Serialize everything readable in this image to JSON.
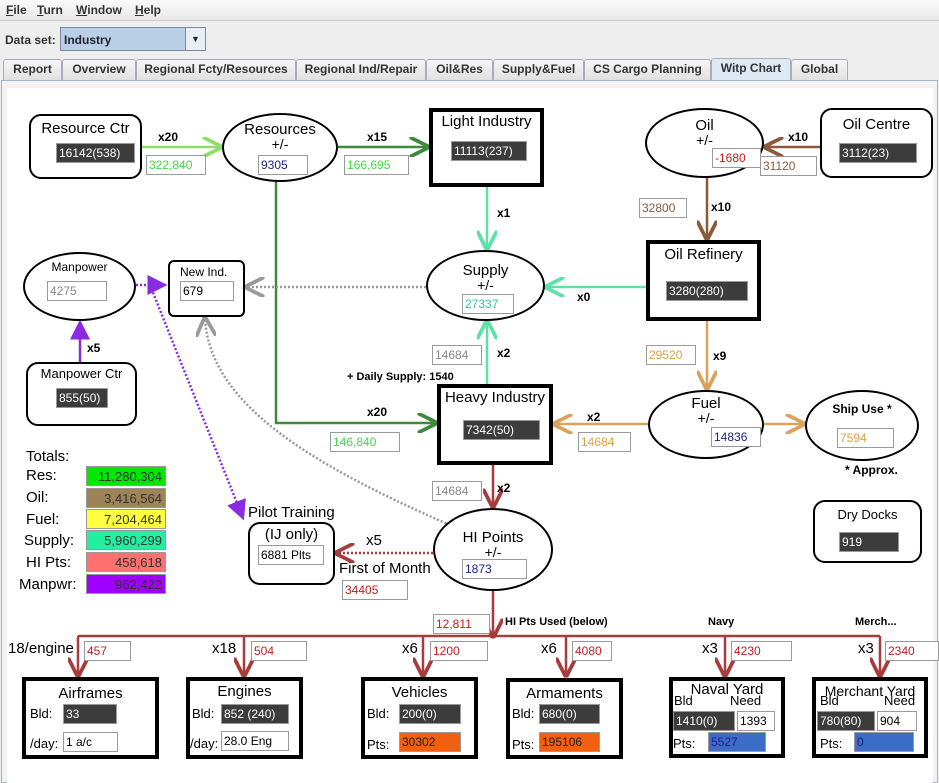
{
  "menu": [
    "File",
    "Turn",
    "Window",
    "Help"
  ],
  "dataset": {
    "label": "Data set:",
    "value": "Industry"
  },
  "tabs": [
    "Report",
    "Overview",
    "Regional Fcty/Resources",
    "Regional Ind/Repair",
    "Oil&Res",
    "Supply&Fuel",
    "CS Cargo Planning",
    "Witp Chart",
    "Global"
  ],
  "active_tab": "Witp Chart",
  "colors": {
    "resources": "#8fdc6a",
    "resources_dark": "#3d8a3d",
    "supply": "#5fe0a8",
    "oil": "#8b5a3c",
    "fuel": "#d9a35e",
    "hi": "#a83c3c",
    "manpower": "#8a2be2"
  },
  "chart": {
    "resource_ctr": {
      "title": "Resource Ctr",
      "value": "16142(538)",
      "mult": "x20",
      "flow": "322,840"
    },
    "resources": {
      "title": "Resources",
      "pm": "+/-",
      "value": "9305",
      "mult": "x15",
      "flow": "166,695"
    },
    "light_industry": {
      "title": "Light Industry",
      "value": "11113(237)",
      "mult": "x1"
    },
    "oil": {
      "title": "Oil",
      "pm": "+/-",
      "value": "-1680"
    },
    "oil_centre": {
      "title": "Oil Centre",
      "value": "3112(23)",
      "mult": "x10",
      "flow": "31120"
    },
    "oil_refinery": {
      "title": "Oil Refinery",
      "value": "3280(280)",
      "in_flow": "32800",
      "in_mult": "x10",
      "supply_mult": "x0",
      "fuel_flow": "29520",
      "fuel_mult": "x9"
    },
    "supply": {
      "title": "Supply",
      "pm": "+/-",
      "value": "27337"
    },
    "new_ind": {
      "title": "New Ind.",
      "value": "679"
    },
    "manpower": {
      "title": "Manpower",
      "value": "4275"
    },
    "manpower_ctr": {
      "title": "Manpower Ctr",
      "value": "855(50)",
      "mult": "x5"
    },
    "heavy_industry": {
      "title": "Heavy Industry",
      "value": "7342(50)",
      "supply_flow": "14684",
      "supply_mult": "x2",
      "daily_supply": "+ Daily Supply: 1540",
      "res_mult": "x20",
      "res_flow": "146,840",
      "fuel_mult": "x2",
      "fuel_flow": "14684",
      "hi_flow": "14684",
      "hi_mult": "x2"
    },
    "fuel": {
      "title": "Fuel",
      "pm": "+/-",
      "value": "14836"
    },
    "ship_use": {
      "title": "Ship Use *",
      "value": "7594",
      "note": "* Approx."
    },
    "hi_points": {
      "title": "HI Points",
      "pm": "+/-",
      "value": "1873",
      "used": "12,811",
      "used_label": "HI Pts Used (below)"
    },
    "dry_docks": {
      "title": "Dry Docks",
      "value": "919"
    },
    "pilot_training": {
      "title": "Pilot Training",
      "sub": "(IJ only)",
      "value": "6881 Plts",
      "mult": "x5",
      "when": "First of Month",
      "flow": "34405"
    },
    "totals": {
      "title": "Totals:",
      "items": [
        {
          "label": "Res:",
          "value": "11,280,304",
          "color": "#00e800"
        },
        {
          "label": "Oil:",
          "value": "3,416,564",
          "color": "#9c8458"
        },
        {
          "label": "Fuel:",
          "value": "7,204,464",
          "color": "#ffff40"
        },
        {
          "label": "Supply:",
          "value": "5,960,299",
          "color": "#20f0a0"
        },
        {
          "label": "HI Pts:",
          "value": "458,618",
          "color": "#ff7070"
        },
        {
          "label": "Manpwr:",
          "value": "962,422",
          "color": "#a000ff"
        }
      ]
    },
    "branches": {
      "navy_label": "Navy",
      "merch_label": "Merch...",
      "airframes": {
        "mult": "18/engine",
        "flow": "457",
        "title": "Airframes",
        "bld_label": "Bld:",
        "bld": "33",
        "day_label": "/day:",
        "day": "1 a/c"
      },
      "engines": {
        "mult": "x18",
        "flow": "504",
        "title": "Engines",
        "bld_label": "Bld:",
        "bld": "852 (240)",
        "day_label": "/day:",
        "day": "28.0 Eng"
      },
      "vehicles": {
        "mult": "x6",
        "flow": "1200",
        "title": "Vehicles",
        "bld_label": "Bld:",
        "bld": "200(0)",
        "pts_label": "Pts:",
        "pts": "30302"
      },
      "armaments": {
        "mult": "x6",
        "flow": "4080",
        "title": "Armaments",
        "bld_label": "Bld:",
        "bld": "680(0)",
        "pts_label": "Pts:",
        "pts": "195106"
      },
      "naval_yard": {
        "mult": "x3",
        "flow": "4230",
        "title": "Naval Yard",
        "bld_label": "Bld",
        "need_label": "Need",
        "bld": "1410(0)",
        "need": "1393",
        "pts_label": "Pts:",
        "pts": "5527"
      },
      "merchant_yard": {
        "mult": "x3",
        "flow": "2340",
        "title": "Merchant Yard",
        "bld_label": "Bld",
        "need_label": "Need",
        "bld": "780(80)",
        "need": "904",
        "pts_label": "Pts:",
        "pts": "0"
      }
    }
  }
}
